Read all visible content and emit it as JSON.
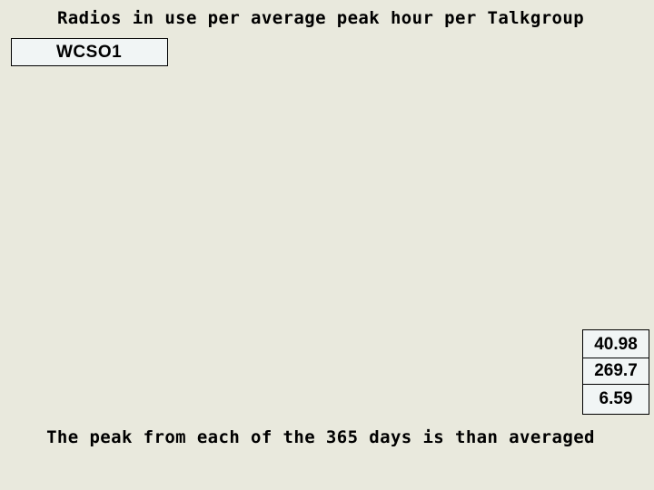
{
  "title": "Radios in use per average peak hour per Talkgroup",
  "talkgroup": {
    "label": "WCSO1"
  },
  "values": [
    "40.98",
    "269.7",
    "6.59"
  ],
  "footer": "The peak from each of the 365 days is than averaged",
  "colors": {
    "background": "#E9E9DD",
    "box_fill": "#F1F5F5",
    "text": "#000000"
  }
}
